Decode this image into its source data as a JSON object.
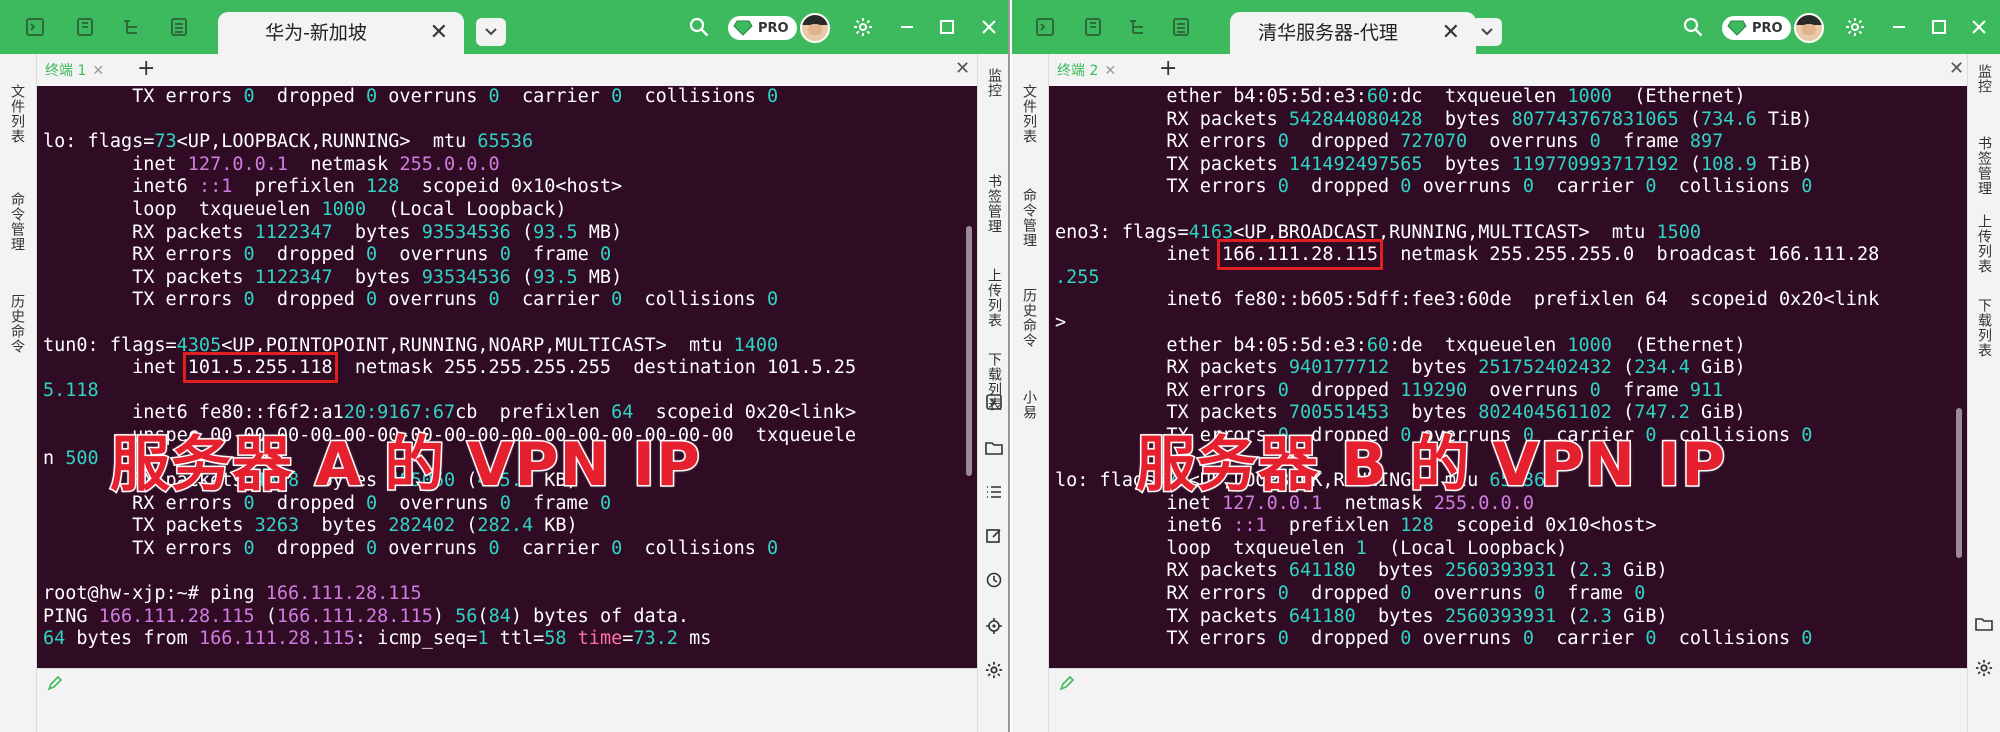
{
  "windows": [
    {
      "tab_title": "华为-新加坡",
      "pro_label": "PRO",
      "subtab_label": "终端 1",
      "left_sidebar": [
        "文件列表",
        "命令管理",
        "历史命令"
      ],
      "right_sidebar": [
        "监控",
        "书签管理",
        "上传列表",
        "下载列表"
      ],
      "right_icons": [
        "terminal-icon",
        "folder-icon",
        "list-icon",
        "edit-icon",
        "history-icon",
        "locate-icon",
        "settings-icon"
      ],
      "overlay_label": "服务器 A 的 VPN IP",
      "terminal_lines": [
        [
          {
            "t": "        TX errors "
          },
          {
            "t": "0",
            "c": "n"
          },
          {
            "t": "  dropped "
          },
          {
            "t": "0",
            "c": "n"
          },
          {
            "t": " overruns "
          },
          {
            "t": "0",
            "c": "n"
          },
          {
            "t": "  carrier "
          },
          {
            "t": "0",
            "c": "n"
          },
          {
            "t": "  collisions "
          },
          {
            "t": "0",
            "c": "n"
          }
        ],
        [
          {
            "t": ""
          }
        ],
        [
          {
            "t": "lo: flags="
          },
          {
            "t": "73",
            "c": "n"
          },
          {
            "t": "<UP,LOOPBACK,RUNNING>  mtu "
          },
          {
            "t": "65536",
            "c": "n"
          }
        ],
        [
          {
            "t": "        inet "
          },
          {
            "t": "127.0.0.1",
            "c": "p"
          },
          {
            "t": "  netmask "
          },
          {
            "t": "255.0.0.0",
            "c": "p"
          }
        ],
        [
          {
            "t": "        inet6 "
          },
          {
            "t": "::1",
            "c": "p"
          },
          {
            "t": "  prefixlen "
          },
          {
            "t": "128",
            "c": "n"
          },
          {
            "t": "  scopeid 0x10<host>"
          }
        ],
        [
          {
            "t": "        loop  txqueuelen "
          },
          {
            "t": "1000",
            "c": "n"
          },
          {
            "t": "  (Local Loopback)"
          }
        ],
        [
          {
            "t": "        RX packets "
          },
          {
            "t": "1122347",
            "c": "n"
          },
          {
            "t": "  bytes "
          },
          {
            "t": "93534536",
            "c": "n"
          },
          {
            "t": " ("
          },
          {
            "t": "93.5",
            "c": "n"
          },
          {
            "t": " MB)"
          }
        ],
        [
          {
            "t": "        RX errors "
          },
          {
            "t": "0",
            "c": "n"
          },
          {
            "t": "  dropped "
          },
          {
            "t": "0",
            "c": "n"
          },
          {
            "t": "  overruns "
          },
          {
            "t": "0",
            "c": "n"
          },
          {
            "t": "  frame "
          },
          {
            "t": "0",
            "c": "n"
          }
        ],
        [
          {
            "t": "        TX packets "
          },
          {
            "t": "1122347",
            "c": "n"
          },
          {
            "t": "  bytes "
          },
          {
            "t": "93534536",
            "c": "n"
          },
          {
            "t": " ("
          },
          {
            "t": "93.5",
            "c": "n"
          },
          {
            "t": " MB)"
          }
        ],
        [
          {
            "t": "        TX errors "
          },
          {
            "t": "0",
            "c": "n"
          },
          {
            "t": "  dropped "
          },
          {
            "t": "0",
            "c": "n"
          },
          {
            "t": " overruns "
          },
          {
            "t": "0",
            "c": "n"
          },
          {
            "t": "  carrier "
          },
          {
            "t": "0",
            "c": "n"
          },
          {
            "t": "  collisions "
          },
          {
            "t": "0",
            "c": "n"
          }
        ],
        [
          {
            "t": ""
          }
        ],
        [
          {
            "t": "tun0: flags="
          },
          {
            "t": "4305",
            "c": "n"
          },
          {
            "t": "<UP,POINTOPOINT,RUNNING,NOARP,MULTICAST>  mtu "
          },
          {
            "t": "1400",
            "c": "n"
          }
        ],
        [
          {
            "t": "        inet "
          },
          {
            "t": "101.5.255.118",
            "c": "box"
          },
          {
            "t": "  netmask 255.255.255.255  destination 101.5.25"
          }
        ],
        [
          {
            "t": "5.118",
            "c": "n"
          }
        ],
        [
          {
            "t": "        inet6 fe80::f6f2:a1"
          },
          {
            "t": "20:9167:67",
            "c": "n"
          },
          {
            "t": "cb  prefixlen "
          },
          {
            "t": "64",
            "c": "n"
          },
          {
            "t": "  scopeid 0x20<link>"
          }
        ],
        [
          {
            "t": "        unspec 00-00-00-00-00-00-00-00-00-00-00-00-00-00-00-00  txqueuele"
          }
        ],
        [
          {
            "t": "n "
          },
          {
            "t": "500",
            "c": "n"
          }
        ],
        [
          {
            "t": "        RX packets "
          },
          {
            "t": "4598",
            "c": "n"
          },
          {
            "t": "  bytes "
          },
          {
            "t": "485060",
            "c": "n"
          },
          {
            "t": " ("
          },
          {
            "t": "485.0",
            "c": "n"
          },
          {
            "t": " KB)"
          }
        ],
        [
          {
            "t": "        RX errors "
          },
          {
            "t": "0",
            "c": "n"
          },
          {
            "t": "  dropped "
          },
          {
            "t": "0",
            "c": "n"
          },
          {
            "t": "  overruns "
          },
          {
            "t": "0",
            "c": "n"
          },
          {
            "t": "  frame "
          },
          {
            "t": "0",
            "c": "n"
          }
        ],
        [
          {
            "t": "        TX packets "
          },
          {
            "t": "3263",
            "c": "n"
          },
          {
            "t": "  bytes "
          },
          {
            "t": "282402",
            "c": "n"
          },
          {
            "t": " ("
          },
          {
            "t": "282.4",
            "c": "n"
          },
          {
            "t": " KB)"
          }
        ],
        [
          {
            "t": "        TX errors "
          },
          {
            "t": "0",
            "c": "n"
          },
          {
            "t": "  dropped "
          },
          {
            "t": "0",
            "c": "n"
          },
          {
            "t": " overruns "
          },
          {
            "t": "0",
            "c": "n"
          },
          {
            "t": "  carrier "
          },
          {
            "t": "0",
            "c": "n"
          },
          {
            "t": "  collisions "
          },
          {
            "t": "0",
            "c": "n"
          }
        ],
        [
          {
            "t": ""
          }
        ],
        [
          {
            "t": "root@hw-xjp:~# ping "
          },
          {
            "t": "166.111.28.115",
            "c": "p"
          }
        ],
        [
          {
            "t": "PING "
          },
          {
            "t": "166.111.28.115",
            "c": "p"
          },
          {
            "t": " ("
          },
          {
            "t": "166.111.28.115",
            "c": "p"
          },
          {
            "t": ") "
          },
          {
            "t": "56",
            "c": "n"
          },
          {
            "t": "("
          },
          {
            "t": "84",
            "c": "n"
          },
          {
            "t": ") bytes of data."
          }
        ],
        [
          {
            "t": "64",
            "c": "n"
          },
          {
            "t": " bytes from "
          },
          {
            "t": "166.111.28.115",
            "c": "p"
          },
          {
            "t": ": icmp_seq="
          },
          {
            "t": "1",
            "c": "n"
          },
          {
            "t": " ttl="
          },
          {
            "t": "58",
            "c": "n"
          },
          {
            "t": " "
          },
          {
            "t": "time",
            "c": "hl"
          },
          {
            "t": "="
          },
          {
            "t": "73.2",
            "c": "n"
          },
          {
            "t": " ms"
          }
        ]
      ]
    },
    {
      "tab_title": "清华服务器-代理",
      "pro_label": "PRO",
      "subtab_label": "终端 2",
      "left_sidebar": [
        "文件列表",
        "命令管理",
        "历史命令",
        "小易"
      ],
      "right_sidebar": [
        "监控",
        "书签管理",
        "上传列表",
        "下载列表"
      ],
      "right_icons": [
        "folder-icon",
        "settings-icon"
      ],
      "overlay_label": "服务器 B 的 VPN IP",
      "terminal_lines": [
        [
          {
            "t": "          ether b4:05:5d:e3:"
          },
          {
            "t": "60",
            "c": "n"
          },
          {
            "t": ":dc  txqueuelen "
          },
          {
            "t": "1000",
            "c": "n"
          },
          {
            "t": "  (Ethernet)"
          }
        ],
        [
          {
            "t": "          RX packets "
          },
          {
            "t": "542844080428",
            "c": "n"
          },
          {
            "t": "  bytes "
          },
          {
            "t": "807743767831065",
            "c": "n"
          },
          {
            "t": " ("
          },
          {
            "t": "734.6",
            "c": "n"
          },
          {
            "t": " TiB)"
          }
        ],
        [
          {
            "t": "          RX errors "
          },
          {
            "t": "0",
            "c": "n"
          },
          {
            "t": "  dropped "
          },
          {
            "t": "727070",
            "c": "n"
          },
          {
            "t": "  overruns "
          },
          {
            "t": "0",
            "c": "n"
          },
          {
            "t": "  frame "
          },
          {
            "t": "897",
            "c": "n"
          }
        ],
        [
          {
            "t": "          TX packets "
          },
          {
            "t": "141492497565",
            "c": "n"
          },
          {
            "t": "  bytes "
          },
          {
            "t": "119770993717192",
            "c": "n"
          },
          {
            "t": " ("
          },
          {
            "t": "108.9",
            "c": "n"
          },
          {
            "t": " TiB)"
          }
        ],
        [
          {
            "t": "          TX errors "
          },
          {
            "t": "0",
            "c": "n"
          },
          {
            "t": "  dropped "
          },
          {
            "t": "0",
            "c": "n"
          },
          {
            "t": " overruns "
          },
          {
            "t": "0",
            "c": "n"
          },
          {
            "t": "  carrier "
          },
          {
            "t": "0",
            "c": "n"
          },
          {
            "t": "  collisions "
          },
          {
            "t": "0",
            "c": "n"
          }
        ],
        [
          {
            "t": ""
          }
        ],
        [
          {
            "t": "eno3: flags="
          },
          {
            "t": "4163",
            "c": "n"
          },
          {
            "t": "<UP,BROADCAST,RUNNING,MULTICAST>  mtu "
          },
          {
            "t": "1500",
            "c": "n"
          }
        ],
        [
          {
            "t": "          inet "
          },
          {
            "t": "166.111.28.115",
            "c": "box"
          },
          {
            "t": "  netmask 255.255.255.0  broadcast 166.111.28"
          }
        ],
        [
          {
            "t": ".255",
            "c": "n"
          }
        ],
        [
          {
            "t": "          inet6 fe80::b605:5dff:fee3:60de  prefixlen 64  scopeid 0x20<link"
          }
        ],
        [
          {
            "t": ">"
          }
        ],
        [
          {
            "t": "          ether b4:05:5d:e3:"
          },
          {
            "t": "60",
            "c": "n"
          },
          {
            "t": ":de  txqueuelen "
          },
          {
            "t": "1000",
            "c": "n"
          },
          {
            "t": "  (Ethernet)"
          }
        ],
        [
          {
            "t": "          RX packets "
          },
          {
            "t": "940177712",
            "c": "n"
          },
          {
            "t": "  bytes "
          },
          {
            "t": "251752402432",
            "c": "n"
          },
          {
            "t": " ("
          },
          {
            "t": "234.4",
            "c": "n"
          },
          {
            "t": " GiB)"
          }
        ],
        [
          {
            "t": "          RX errors "
          },
          {
            "t": "0",
            "c": "n"
          },
          {
            "t": "  dropped "
          },
          {
            "t": "119290",
            "c": "n"
          },
          {
            "t": "  overruns "
          },
          {
            "t": "0",
            "c": "n"
          },
          {
            "t": "  frame "
          },
          {
            "t": "911",
            "c": "n"
          }
        ],
        [
          {
            "t": "          TX packets "
          },
          {
            "t": "700551453",
            "c": "n"
          },
          {
            "t": "  bytes "
          },
          {
            "t": "802404561102",
            "c": "n"
          },
          {
            "t": " ("
          },
          {
            "t": "747.2",
            "c": "n"
          },
          {
            "t": " GiB)"
          }
        ],
        [
          {
            "t": "          TX errors "
          },
          {
            "t": "0",
            "c": "n"
          },
          {
            "t": "  dropped "
          },
          {
            "t": "0",
            "c": "n"
          },
          {
            "t": " overruns "
          },
          {
            "t": "0",
            "c": "n"
          },
          {
            "t": "  carrier "
          },
          {
            "t": "0",
            "c": "n"
          },
          {
            "t": "  collisions "
          },
          {
            "t": "0",
            "c": "n"
          }
        ],
        [
          {
            "t": ""
          }
        ],
        [
          {
            "t": "lo: flags="
          },
          {
            "t": "73",
            "c": "n"
          },
          {
            "t": "<UP,LOOPBACK,RUNNING>  mtu "
          },
          {
            "t": "65536",
            "c": "n"
          }
        ],
        [
          {
            "t": "          inet "
          },
          {
            "t": "127.0.0.1",
            "c": "p"
          },
          {
            "t": "  netmask "
          },
          {
            "t": "255.0.0.0",
            "c": "p"
          }
        ],
        [
          {
            "t": "          inet6 "
          },
          {
            "t": "::1",
            "c": "p"
          },
          {
            "t": "  prefixlen "
          },
          {
            "t": "128",
            "c": "n"
          },
          {
            "t": "  scopeid 0x10<host>"
          }
        ],
        [
          {
            "t": "          loop  txqueuelen "
          },
          {
            "t": "1",
            "c": "n"
          },
          {
            "t": "  (Local Loopback)"
          }
        ],
        [
          {
            "t": "          RX packets "
          },
          {
            "t": "641180",
            "c": "n"
          },
          {
            "t": "  bytes "
          },
          {
            "t": "2560393931",
            "c": "n"
          },
          {
            "t": " ("
          },
          {
            "t": "2.3",
            "c": "n"
          },
          {
            "t": " GiB)"
          }
        ],
        [
          {
            "t": "          RX errors "
          },
          {
            "t": "0",
            "c": "n"
          },
          {
            "t": "  dropped "
          },
          {
            "t": "0",
            "c": "n"
          },
          {
            "t": "  overruns "
          },
          {
            "t": "0",
            "c": "n"
          },
          {
            "t": "  frame "
          },
          {
            "t": "0",
            "c": "n"
          }
        ],
        [
          {
            "t": "          TX packets "
          },
          {
            "t": "641180",
            "c": "n"
          },
          {
            "t": "  bytes "
          },
          {
            "t": "2560393931",
            "c": "n"
          },
          {
            "t": " ("
          },
          {
            "t": "2.3",
            "c": "n"
          },
          {
            "t": " GiB)"
          }
        ],
        [
          {
            "t": "          TX errors "
          },
          {
            "t": "0",
            "c": "n"
          },
          {
            "t": "  dropped "
          },
          {
            "t": "0",
            "c": "n"
          },
          {
            "t": " overruns "
          },
          {
            "t": "0",
            "c": "n"
          },
          {
            "t": "  carrier "
          },
          {
            "t": "0",
            "c": "n"
          },
          {
            "t": "  collisions "
          },
          {
            "t": "0",
            "c": "n"
          }
        ]
      ]
    }
  ],
  "colors": {
    "titlebar": "#3dba5d",
    "terminal_bg": "#2f0b24",
    "number": "#2fd3c4",
    "ip": "#d07ce0",
    "keyword": "#ff6fa8",
    "highlight_box": "#e02020",
    "overlay_text": "#e5202f"
  }
}
